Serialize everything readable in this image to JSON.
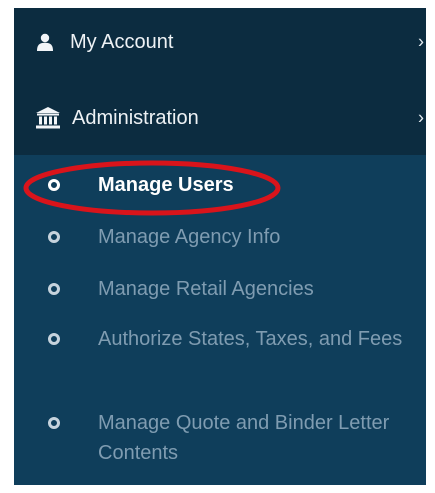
{
  "sidebar": {
    "my_account": {
      "label": "My Account",
      "icon": "user-icon",
      "chevron": "›"
    },
    "administration": {
      "label": "Administration",
      "icon": "bank-icon",
      "chevron": "›",
      "items": [
        {
          "label": "Manage Users",
          "active": true
        },
        {
          "label": "Manage Agency Info",
          "active": false
        },
        {
          "label": "Manage Retail Agencies",
          "active": false
        },
        {
          "label": "Authorize States, Taxes, and Fees",
          "active": false
        },
        {
          "label": "Manage Quote and Binder Letter Contents",
          "active": false
        }
      ]
    }
  },
  "annotation": {
    "shape": "ellipse",
    "color": "#d9141b",
    "target": "Manage Users"
  },
  "colors": {
    "sidebar_bg": "#0c2c40",
    "submenu_bg": "#0f3e5b",
    "active_text": "#ffffff",
    "inactive_text": "#7f9cb1"
  }
}
